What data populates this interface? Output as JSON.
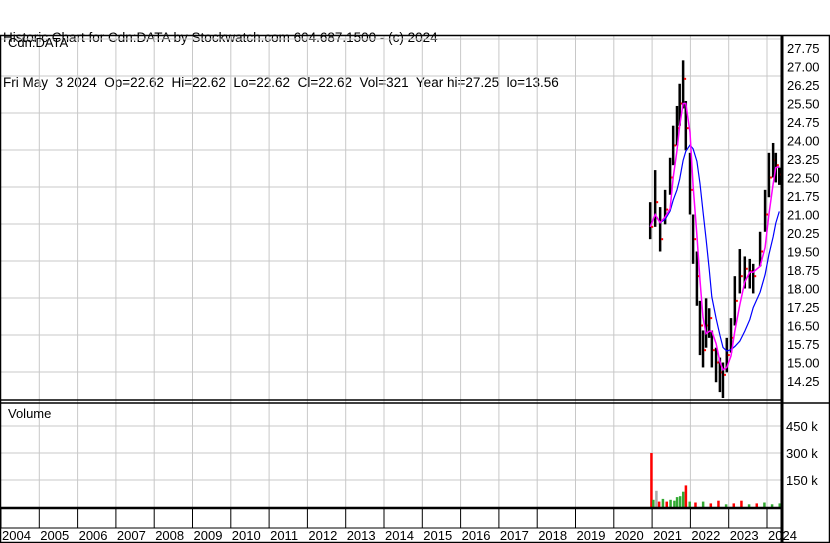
{
  "header": {
    "title": "Historic Chart for Cdn:DATA by Stockwatch.com 604.687.1500 - (c) 2024",
    "quote_line": "Fri May  3 2024  Op=22.62  Hi=22.62  Lo=22.62  Cl=22.62  Vol=321  Year hi=27.25  lo=13.56"
  },
  "chart_data": {
    "type": "line",
    "symbol_label": "Cdn:DATA",
    "volume_label": "Volume",
    "x_ticks": [
      "2004",
      "2005",
      "2006",
      "2007",
      "2008",
      "2009",
      "2010",
      "2011",
      "2012",
      "2013",
      "2014",
      "2015",
      "2016",
      "2017",
      "2018",
      "2019",
      "2020",
      "2021",
      "2022",
      "2023",
      "2024"
    ],
    "xlim": [
      2004,
      2024.4
    ],
    "price_ticks": [
      "27.75",
      "27.00",
      "26.25",
      "25.50",
      "24.75",
      "24.00",
      "23.25",
      "22.50",
      "21.75",
      "21.00",
      "20.25",
      "19.50",
      "18.75",
      "18.00",
      "17.25",
      "16.50",
      "15.75",
      "15.00",
      "14.25"
    ],
    "ylim": [
      13.6,
      28.0
    ],
    "volume_ticks": [
      "450 k",
      "300 k",
      "150 k"
    ],
    "volume_ylim": [
      0,
      560
    ],
    "price_series": {
      "name": "Cdn:DATA",
      "x": [
        2020.95,
        2021.08,
        2021.21,
        2021.34,
        2021.47,
        2021.55,
        2021.65,
        2021.72,
        2021.81,
        2021.88,
        2021.99,
        2022.07,
        2022.17,
        2022.25,
        2022.33,
        2022.41,
        2022.49,
        2022.56,
        2022.67,
        2022.77,
        2022.85,
        2022.95,
        2023.06,
        2023.16,
        2023.29,
        2023.42,
        2023.55,
        2023.64,
        2023.82,
        2023.95,
        2024.05,
        2024.16,
        2024.23,
        2024.32
      ],
      "close": [
        20.5,
        21.5,
        20.0,
        21.2,
        22.5,
        23.8,
        24.5,
        25.5,
        26.5,
        24.5,
        22.0,
        20.0,
        18.5,
        16.5,
        15.5,
        16.5,
        16.8,
        15.5,
        15.0,
        14.6,
        14.5,
        15.3,
        16.0,
        17.5,
        18.5,
        18.8,
        18.7,
        18.5,
        19.5,
        21.0,
        22.5,
        23.2,
        23.0,
        22.62
      ],
      "high": [
        21.5,
        22.8,
        21.3,
        22.0,
        23.3,
        24.6,
        25.4,
        26.3,
        27.25,
        25.6,
        23.5,
        21.0,
        19.5,
        17.5,
        16.3,
        17.6,
        17.2,
        16.3,
        15.6,
        15.2,
        15.0,
        16.0,
        16.8,
        18.5,
        19.6,
        19.3,
        19.2,
        19.0,
        20.3,
        22.0,
        23.5,
        23.9,
        23.5,
        22.9
      ],
      "low": [
        20.0,
        20.5,
        19.5,
        20.6,
        21.8,
        23.0,
        23.8,
        24.6,
        25.3,
        23.6,
        21.0,
        19.0,
        17.3,
        15.3,
        14.8,
        15.6,
        16.0,
        14.8,
        14.2,
        13.8,
        13.56,
        14.6,
        15.4,
        16.5,
        17.8,
        18.0,
        18.0,
        17.8,
        18.9,
        20.3,
        21.7,
        22.5,
        22.3,
        22.2
      ],
      "ma_short": 3,
      "ma_long": 8
    },
    "volume_series": {
      "x": [
        2020.95,
        2021.0,
        2021.08,
        2021.15,
        2021.25,
        2021.35,
        2021.45,
        2021.55,
        2021.62,
        2021.7,
        2021.78,
        2021.85,
        2021.95,
        2022.1,
        2022.3,
        2022.5,
        2022.7,
        2022.9,
        2023.1,
        2023.3,
        2023.5,
        2023.7,
        2023.9,
        2024.1,
        2024.3
      ],
      "values": [
        300,
        40,
        90,
        30,
        45,
        30,
        40,
        35,
        55,
        60,
        85,
        120,
        30,
        25,
        30,
        20,
        35,
        15,
        20,
        35,
        15,
        20,
        25,
        15,
        20
      ],
      "colors": [
        "#ff0000",
        "#33aa33",
        "#aaaaaa",
        "#ff0000",
        "#33aa33",
        "#ff0000",
        "#33aa33",
        "#33aa33",
        "#33aa33",
        "#33aa33",
        "#33aa33",
        "#ff0000",
        "#33aa33",
        "#ff0000",
        "#33aa33",
        "#ff0000",
        "#ff0000",
        "#33aa33",
        "#ff0000",
        "#ff0000",
        "#33aa33",
        "#ff0000",
        "#33aa33",
        "#33aa33",
        "#33aa33"
      ]
    },
    "colors": {
      "bars": "#000000",
      "close_marks": "#ff0000",
      "ma_short": "#ff00ff",
      "ma_long": "#0000ff",
      "grid": "#c8c8c8"
    },
    "grid": true
  }
}
